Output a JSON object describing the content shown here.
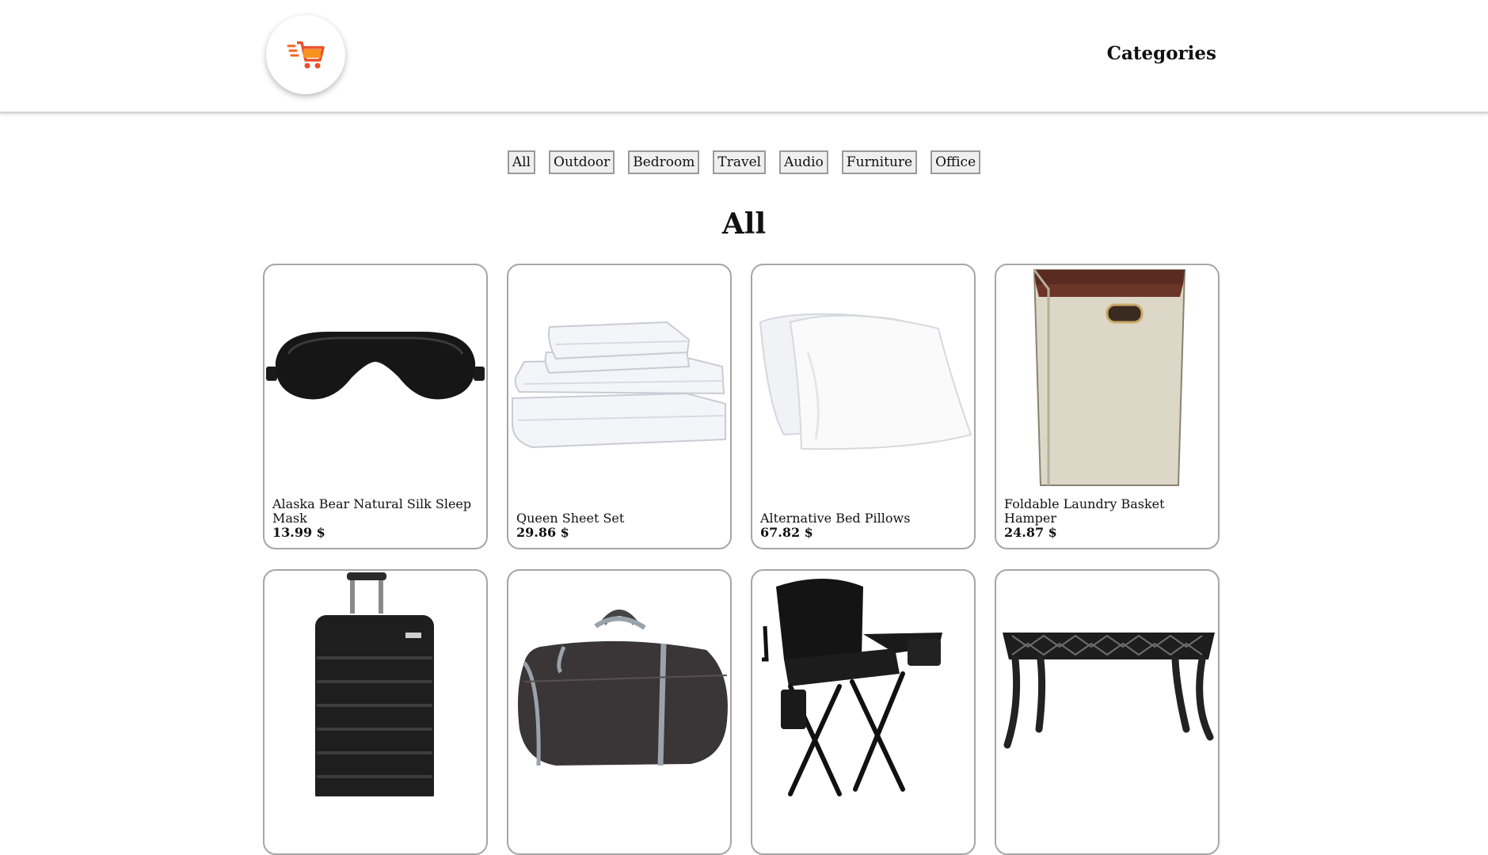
{
  "header": {
    "logo_icon": "shopping-cart-icon",
    "brand_color": "#f26522",
    "categories_label": "Categories"
  },
  "filters": [
    "All",
    "Outdoor",
    "Bedroom",
    "Travel",
    "Audio",
    "Furniture",
    "Office"
  ],
  "section_title": "All",
  "products": [
    {
      "name": "Alaska Bear Natural Silk Sleep Mask",
      "price": "13.99 $",
      "image": "sleep-mask"
    },
    {
      "name": "Queen Sheet Set",
      "price": "29.86 $",
      "image": "sheet-set"
    },
    {
      "name": "Alternative Bed Pillows",
      "price": "67.82 $",
      "image": "bed-pillows"
    },
    {
      "name": "Foldable Laundry Basket Hamper",
      "price": "24.87 $",
      "image": "laundry-hamper"
    },
    {
      "name": "",
      "price": "",
      "image": "suitcase"
    },
    {
      "name": "",
      "price": "",
      "image": "duffel-bag"
    },
    {
      "name": "",
      "price": "",
      "image": "camping-chair"
    },
    {
      "name": "",
      "price": "",
      "image": "camp-grill-table"
    }
  ]
}
